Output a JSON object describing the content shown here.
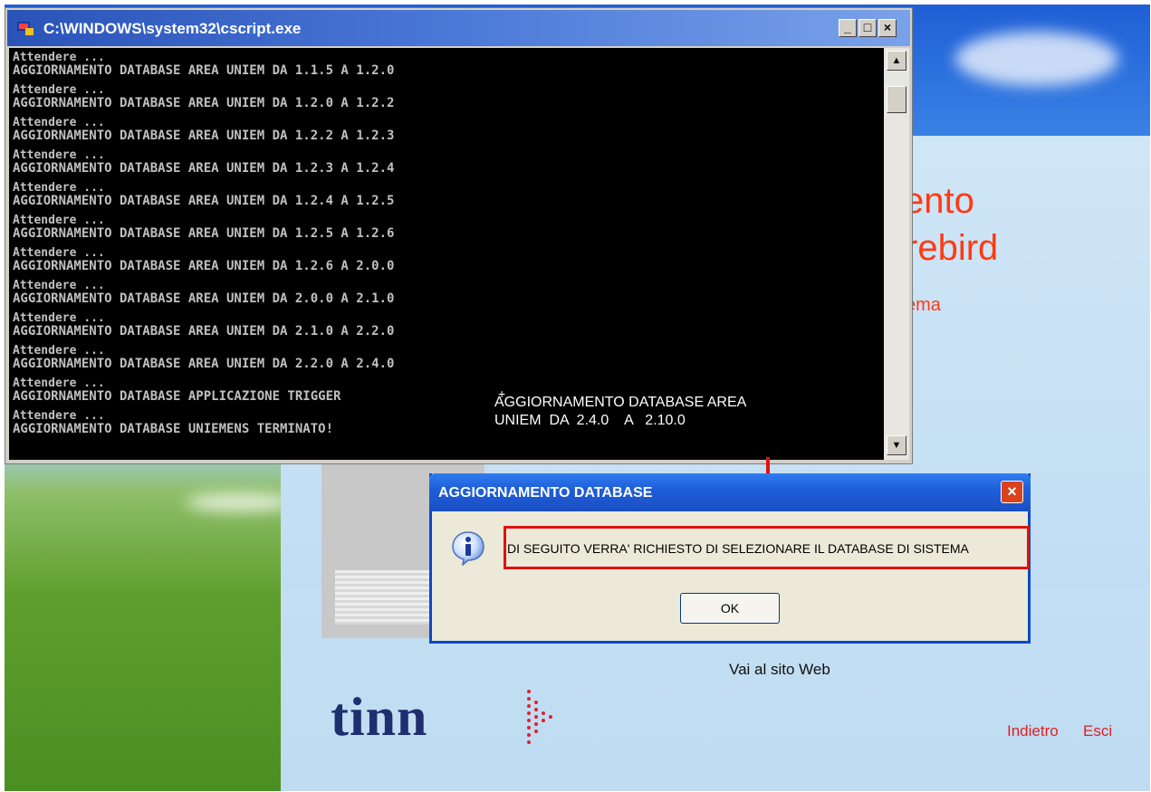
{
  "console": {
    "title": "C:\\WINDOWS\\system32\\cscript.exe",
    "lines": [
      "Attendere ...",
      "AGGIORNAMENTO DATABASE AREA UNIEM DA 1.1.5 A 1.2.0",
      "Attendere ...",
      "AGGIORNAMENTO DATABASE AREA UNIEM DA 1.2.0 A 1.2.2",
      "Attendere ...",
      "AGGIORNAMENTO DATABASE AREA UNIEM DA 1.2.2 A 1.2.3",
      "Attendere ...",
      "AGGIORNAMENTO DATABASE AREA UNIEM DA 1.2.3 A 1.2.4",
      "Attendere ...",
      "AGGIORNAMENTO DATABASE AREA UNIEM DA 1.2.4 A 1.2.5",
      "Attendere ...",
      "AGGIORNAMENTO DATABASE AREA UNIEM DA 1.2.5 A 1.2.6",
      "Attendere ...",
      "AGGIORNAMENTO DATABASE AREA UNIEM DA 1.2.6 A 2.0.0",
      "Attendere ...",
      "AGGIORNAMENTO DATABASE AREA UNIEM DA 2.0.0 A 2.1.0",
      "Attendere ...",
      "AGGIORNAMENTO DATABASE AREA UNIEM DA 2.1.0 A 2.2.0",
      "Attendere ...",
      "AGGIORNAMENTO DATABASE AREA UNIEM DA 2.2.0 A 2.4.0",
      "Attendere ...",
      "AGGIORNAMENTO DATABASE APPLICAZIONE TRIGGER",
      "Attendere ...",
      "AGGIORNAMENTO DATABASE UNIEMENS TERMINATO!"
    ],
    "annotation_plus": "+",
    "annotation_line1": "AGGIORNAMENTO DATABASE AREA",
    "annotation_line2": "UNIEM  DA  2.4.0    A   2.10.0",
    "btn_min": "_",
    "btn_max": "□",
    "btn_close": "×",
    "scroll_up": "▲",
    "scroll_down": "▼"
  },
  "installer": {
    "title_frag1": "ento",
    "title_frag2": "rebird",
    "title_frag3": "ema",
    "web_link": "Vai al sito Web",
    "logo": "tinn",
    "nav_back": "Indietro",
    "nav_exit": "Esci",
    "accent_color": "#ff3a12"
  },
  "dialog": {
    "title": "AGGIORNAMENTO DATABASE",
    "message": "DI SEGUITO VERRA' RICHIESTO DI SELEZIONARE IL DATABASE DI SISTEMA",
    "ok_label": "OK",
    "close_label": "×",
    "icon": "info-icon"
  }
}
